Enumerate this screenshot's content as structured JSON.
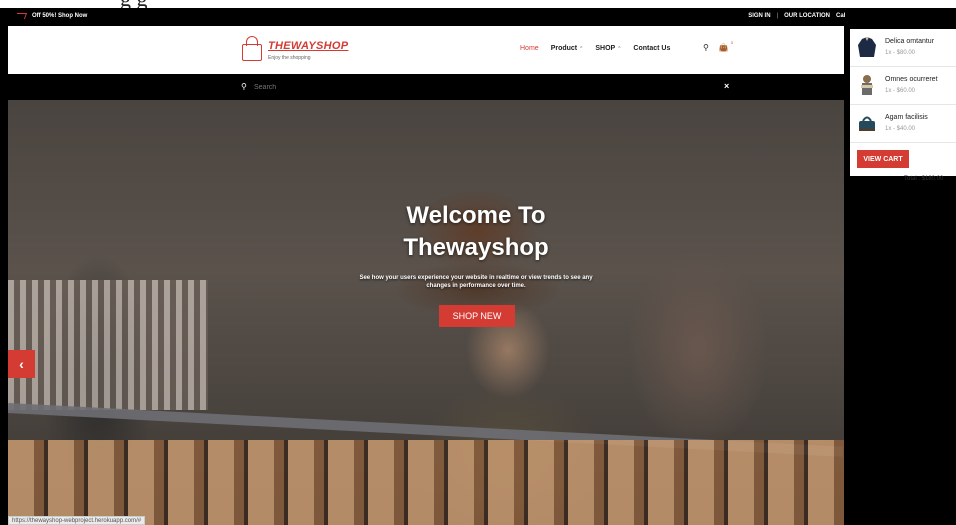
{
  "browser": {
    "cropped_heading": "g  g",
    "status_url": "https://thewayshop-webproject.herokuapp.com/#"
  },
  "topbar": {
    "offer": "Off 50%! Shop Now",
    "sign_in": "SIGN IN",
    "separator": "|",
    "location": "OUR LOCATION",
    "cal": "Cal"
  },
  "logo": {
    "brand": "THEWAYSHOP",
    "tagline": "Enjoy the shopping"
  },
  "nav": {
    "home": "Home",
    "product": "Product",
    "shop": "SHOP",
    "contact": "Contact Us",
    "caret": "⌃",
    "cart_count": "3"
  },
  "search": {
    "placeholder": "Search",
    "close": "×"
  },
  "hero": {
    "title": "Welcome To Thewayshop",
    "subtitle": "See how your users experience your website in realtime or view trends to see any changes in performance over time.",
    "button": "SHOP NEW",
    "prev": "‹"
  },
  "cart": {
    "items": [
      {
        "name": "Delica omtantur",
        "price": "1x - $80.00"
      },
      {
        "name": "Omnes ocurreret",
        "price": "1x - $60.00"
      },
      {
        "name": "Agam facilisis",
        "price": "1x - $40.00"
      }
    ],
    "view_cart": "VIEW CART",
    "total": "Total : $180.00"
  },
  "colors": {
    "accent": "#d33b33",
    "dark": "#000000",
    "panel": "#ffffff"
  }
}
